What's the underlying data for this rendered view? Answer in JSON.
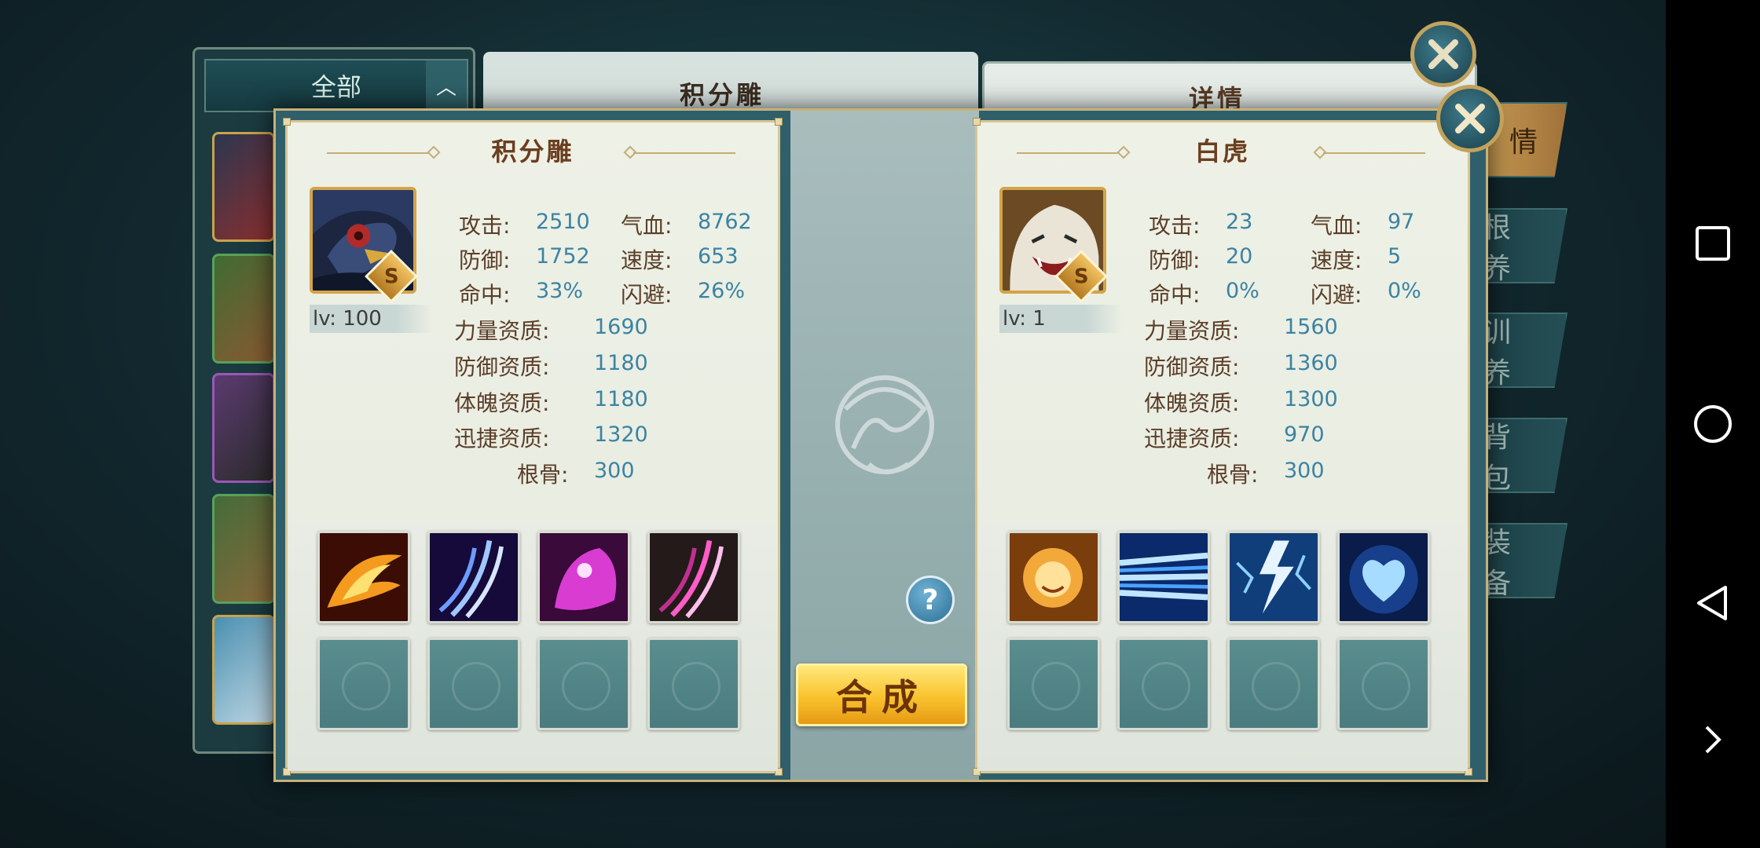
{
  "background": {
    "filter_label": "全部",
    "center_title": "积分雕",
    "right_title": "详情",
    "side_tabs": [
      "情",
      "根 养",
      "训 养",
      "背 包",
      "装 备"
    ]
  },
  "left_pet": {
    "name": "积分雕",
    "rank": "S",
    "level": "lv: 100",
    "attack_label": "攻击:",
    "attack": "2510",
    "hp_label": "气血:",
    "hp": "8762",
    "defense_label": "防御:",
    "defense": "1752",
    "speed_label": "速度:",
    "speed": "653",
    "hit_label": "命中:",
    "hit": "33%",
    "dodge_label": "闪避:",
    "dodge": "26%",
    "strength_apt_label": "力量资质:",
    "strength_apt": "1690",
    "defense_apt_label": "防御资质:",
    "defense_apt": "1180",
    "physique_apt_label": "体魄资质:",
    "physique_apt": "1180",
    "agility_apt_label": "迅捷资质:",
    "agility_apt": "1320",
    "root_label": "根骨:",
    "root": "300",
    "skills": [
      "phoenix-skill-icon",
      "blue-claw-skill-icon",
      "pink-beast-skill-icon",
      "pink-claw-skill-icon"
    ]
  },
  "right_pet": {
    "name": "白虎",
    "rank": "S",
    "level": "lv: 1",
    "attack_label": "攻击:",
    "attack": "23",
    "hp_label": "气血:",
    "hp": "97",
    "defense_label": "防御:",
    "defense": "20",
    "speed_label": "速度:",
    "speed": "5",
    "hit_label": "命中:",
    "hit": "0%",
    "dodge_label": "闪避:",
    "dodge": "0%",
    "strength_apt_label": "力量资质:",
    "strength_apt": "1560",
    "defense_apt_label": "防御资质:",
    "defense_apt": "1360",
    "physique_apt_label": "体魄资质:",
    "physique_apt": "1300",
    "agility_apt_label": "迅捷资质:",
    "agility_apt": "970",
    "root_label": "根骨:",
    "root": "300",
    "skills": [
      "golden-lion-skill-icon",
      "blue-slash-skill-icon",
      "lightning-skill-icon",
      "blue-heart-skill-icon"
    ]
  },
  "actions": {
    "help": "?",
    "merge": "合成"
  },
  "colors": {
    "stat_value": "#3b83a3",
    "stat_label": "#5b3e28",
    "title": "#6b3e1f",
    "merge_button": "#f9c22d"
  }
}
